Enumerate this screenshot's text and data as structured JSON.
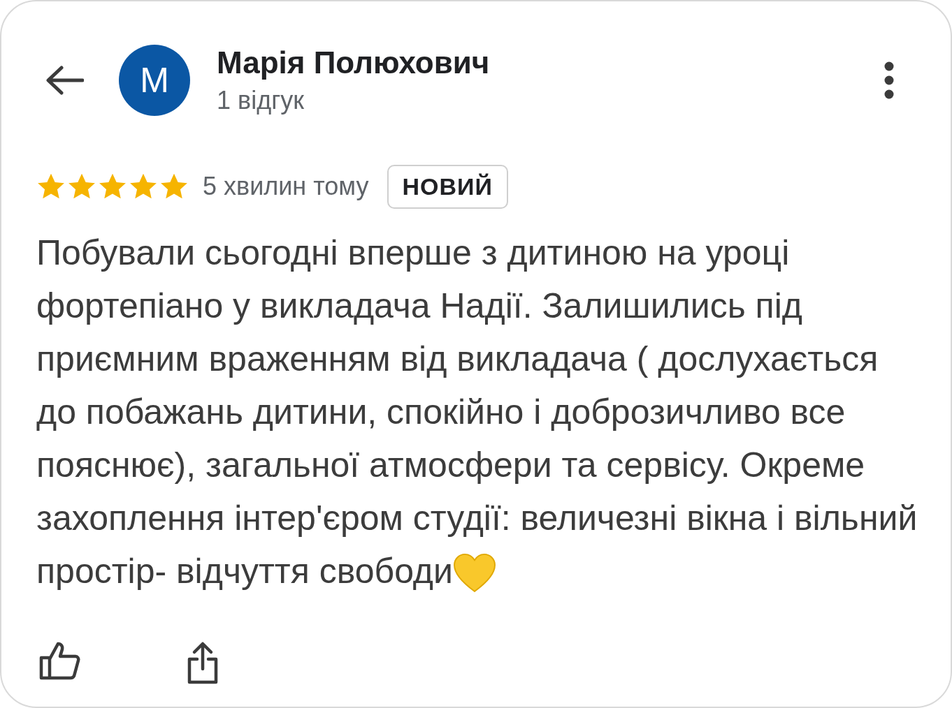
{
  "author": {
    "initial": "M",
    "name": "Марія Полюхович",
    "reviews": "1 відгук"
  },
  "review": {
    "stars": 5,
    "time": "5 хвилин тому",
    "badge": "НОВИЙ",
    "text": "Побували сьогодні вперше з дитиною на уроці фортепіано у викладача Надії. Залишились під приємним враженням від викладача ( дослухається до побажань дитини, спокійно і доброзичливо все пояснює), загальної атмосфери та сервісу. Окреме захоплення інтер'єром студії: величезні вікна і вільний простір- відчуття свободи"
  }
}
